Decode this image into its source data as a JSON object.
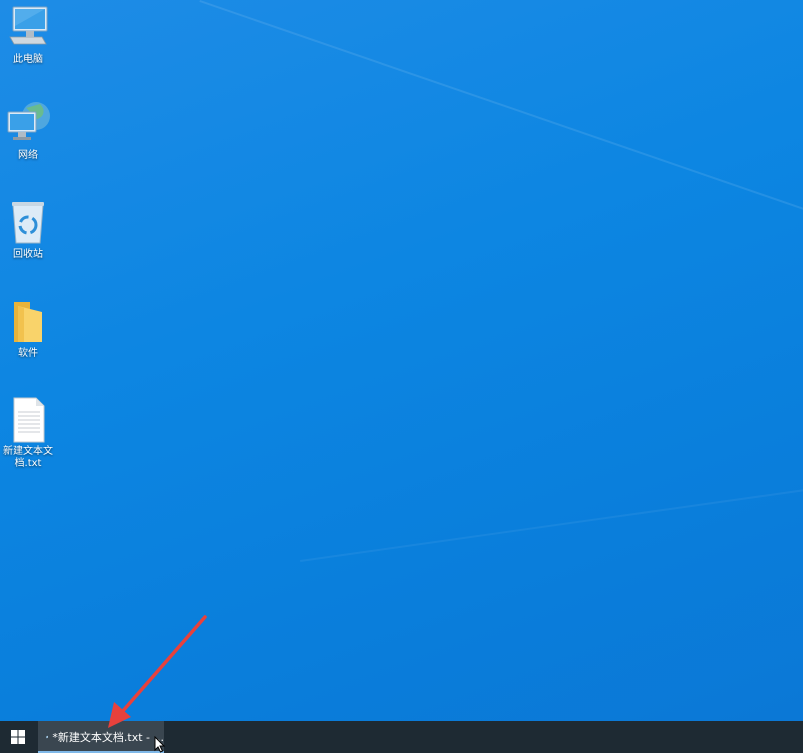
{
  "desktop": {
    "icons": [
      {
        "label": "此电脑",
        "icon": "this-pc-icon"
      },
      {
        "label": "网络",
        "icon": "network-icon"
      },
      {
        "label": "回收站",
        "icon": "recycle-bin-icon"
      },
      {
        "label": "软件",
        "icon": "folder-icon"
      },
      {
        "label": "新建文本文档.txt",
        "icon": "text-document-icon"
      }
    ]
  },
  "taskbar": {
    "start_icon": "windows-logo-icon",
    "items": [
      {
        "label": "*新建文本文档.txt - ...",
        "icon": "notepad-icon",
        "active": true
      }
    ]
  },
  "colors": {
    "desktop_bg": "#0d86e2",
    "taskbar_bg": "#1e2a33",
    "task_item_bg": "#3a4650",
    "annotation_arrow": "#e8413c"
  }
}
